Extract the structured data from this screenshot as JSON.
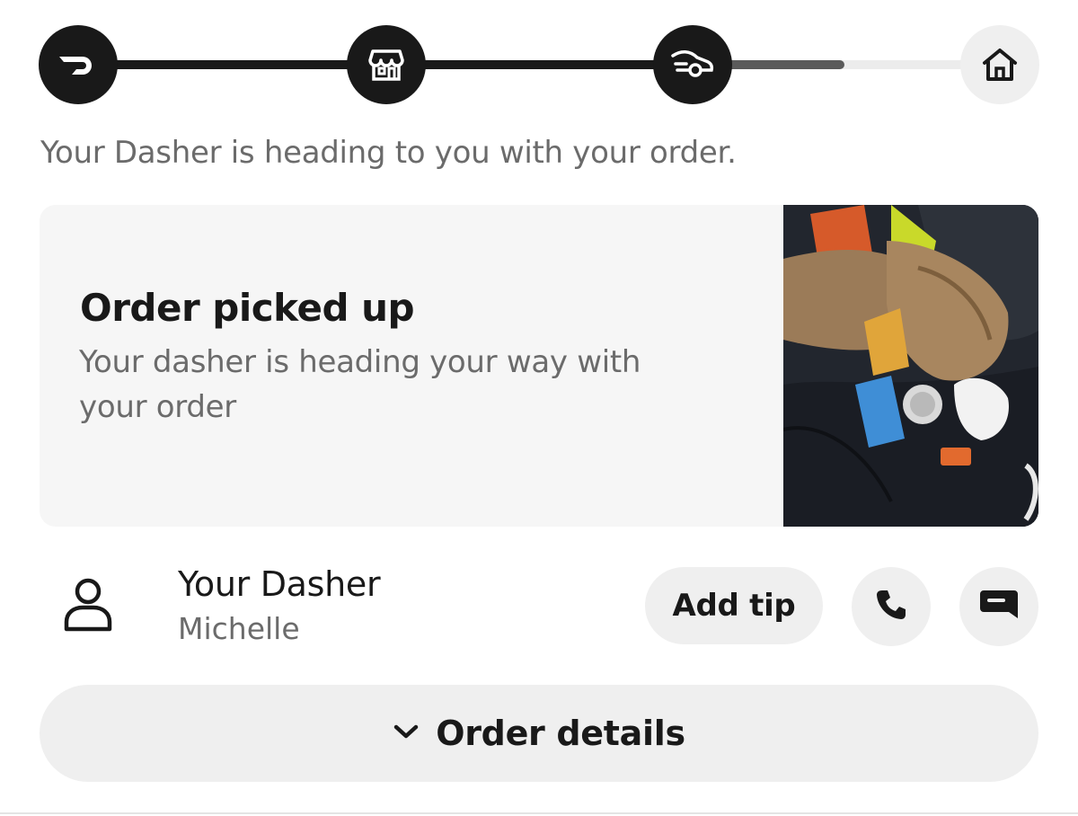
{
  "progress": {
    "steps": [
      {
        "icon": "doordash-logo-icon",
        "state": "done"
      },
      {
        "icon": "store-icon",
        "state": "done"
      },
      {
        "icon": "car-icon",
        "state": "current"
      },
      {
        "icon": "home-icon",
        "state": "pending"
      }
    ],
    "current_segment_fraction": 0.5
  },
  "status_message": "Your Dasher is heading to you with your order.",
  "status_card": {
    "title": "Order picked up",
    "subtitle": "Your dasher is heading your way with your order",
    "photo": "order-photo"
  },
  "dasher": {
    "label": "Your Dasher",
    "name": "Michelle",
    "add_tip_label": "Add tip",
    "call_icon": "phone-icon",
    "message_icon": "chat-icon"
  },
  "order_details": {
    "label": "Order details",
    "icon": "chevron-down-icon"
  },
  "colors": {
    "primary": "#191919",
    "muted_text": "#6b6b6b",
    "surface": "#f6f6f6",
    "button_bg": "#efefef"
  }
}
